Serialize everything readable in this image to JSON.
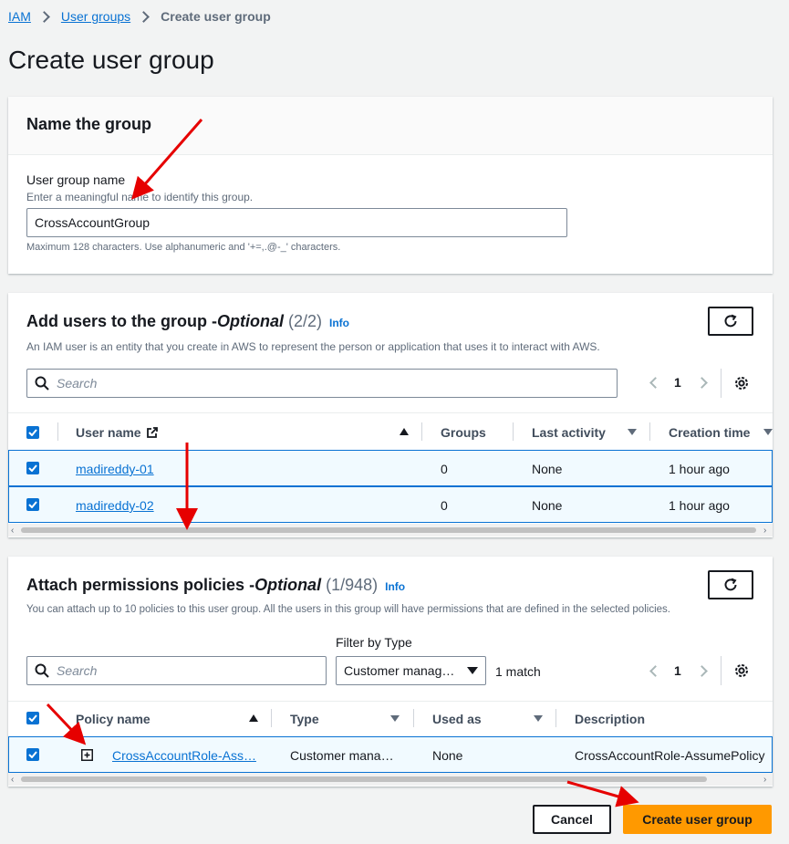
{
  "breadcrumb": {
    "root": "IAM",
    "parent": "User groups",
    "current": "Create user group"
  },
  "page_title": "Create user group",
  "name_section": {
    "heading": "Name the group",
    "label": "User group name",
    "description": "Enter a meaningful name to identify this group.",
    "value": "CrossAccountGroup",
    "constraint": "Maximum 128 characters. Use alphanumeric and '+=,.@-_' characters."
  },
  "users_section": {
    "heading": "Add users to the group - ",
    "optional": "Optional",
    "count": "(2/2)",
    "info": "Info",
    "description": "An IAM user is an entity that you create in AWS to represent the person or application that uses it to interact with AWS.",
    "search_placeholder": "Search",
    "page": "1",
    "columns": {
      "user_name": "User name",
      "groups": "Groups",
      "last_activity": "Last activity",
      "creation_time": "Creation time"
    },
    "rows": [
      {
        "user_name": "madireddy-01",
        "groups": "0",
        "last_activity": "None",
        "creation_time": "1 hour ago"
      },
      {
        "user_name": "madireddy-02",
        "groups": "0",
        "last_activity": "None",
        "creation_time": "1 hour ago"
      }
    ]
  },
  "policies_section": {
    "heading": "Attach permissions policies - ",
    "optional": "Optional",
    "count": "(1/948)",
    "info": "Info",
    "description": "You can attach up to 10 policies to this user group. All the users in this group will have permissions that are defined in the selected policies.",
    "filter_label": "Filter by Type",
    "filter_value": "Customer manag…",
    "match_count": "1 match",
    "search_placeholder": "Search",
    "page": "1",
    "columns": {
      "policy_name": "Policy name",
      "type": "Type",
      "used_as": "Used as",
      "description": "Description"
    },
    "rows": [
      {
        "policy_name": "CrossAccountRole-Ass…",
        "type": "Customer mana…",
        "used_as": "None",
        "description": "CrossAccountRole-AssumePolicy"
      }
    ]
  },
  "actions": {
    "cancel": "Cancel",
    "create": "Create user group"
  },
  "colors": {
    "link": "#0972d3",
    "primary": "#ff9900",
    "annotation": "#e60000",
    "selected_row": "#f1faff"
  }
}
